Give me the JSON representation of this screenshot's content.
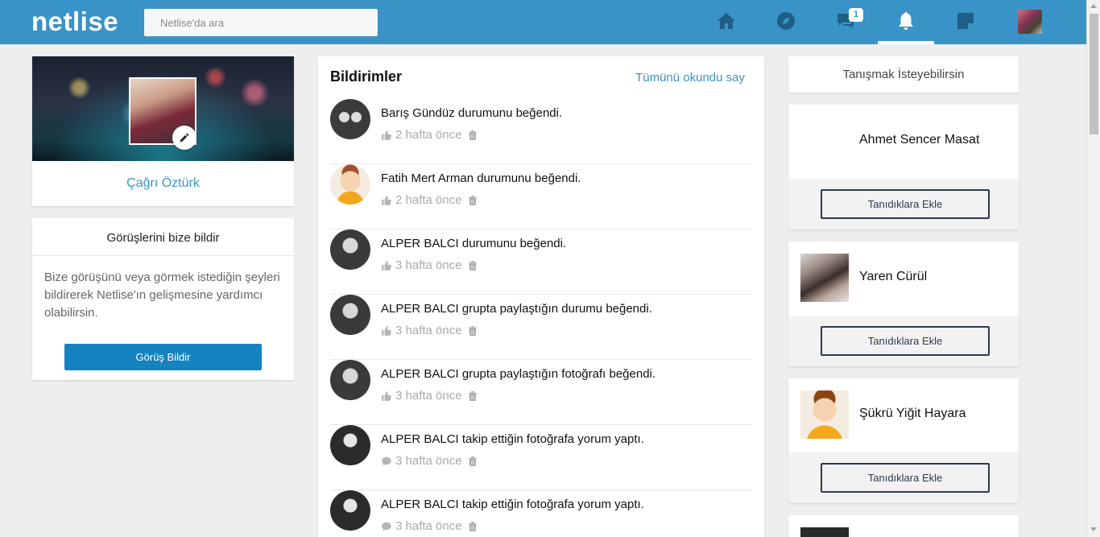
{
  "app": {
    "logo": "netlise"
  },
  "search": {
    "placeholder": "Netlise'da ara"
  },
  "nav": {
    "icons": [
      "home-icon",
      "compass-icon",
      "messages-icon",
      "bell-icon",
      "notes-icon"
    ],
    "messages_badge": "1",
    "active": "bell-icon"
  },
  "profile": {
    "name": "Çağrı Öztürk"
  },
  "feedback": {
    "title": "Görüşlerini bize bildir",
    "text": "Bize görüşünü veya görmek istediğin şeyleri bildirerek Netlise'ın gelişmesine yardımcı olabilirsin.",
    "button": "Görüş Bildir"
  },
  "notifications": {
    "title": "Bildirimler",
    "mark_all_read": "Tümünü okundu say",
    "items": [
      {
        "text": "Barış Gündüz durumunu beğendi.",
        "time": "2 hafta önce",
        "kind": "like"
      },
      {
        "text": "Fatih Mert Arman durumunu beğendi.",
        "time": "2 hafta önce",
        "kind": "like"
      },
      {
        "text": "ALPER BALCI durumunu beğendi.",
        "time": "3 hafta önce",
        "kind": "like"
      },
      {
        "text": "ALPER BALCI grupta paylaştığın durumu beğendi.",
        "time": "3 hafta önce",
        "kind": "like"
      },
      {
        "text": "ALPER BALCI grupta paylaştığın fotoğrafı beğendi.",
        "time": "3 hafta önce",
        "kind": "like"
      },
      {
        "text": "ALPER BALCI takip ettiğin fotoğrafa yorum yaptı.",
        "time": "3 hafta önce",
        "kind": "comment"
      },
      {
        "text": "ALPER BALCI takip ettiğin fotoğrafa yorum yaptı.",
        "time": "3 hafta önce",
        "kind": "comment"
      }
    ]
  },
  "suggestions": {
    "title": "Tanışmak İsteyebilirsin",
    "add_label": "Tanıdıklara Ekle",
    "people": [
      {
        "name": "Ahmet Sencer Masat"
      },
      {
        "name": "Yaren Cürül"
      },
      {
        "name": "Şükrü Yiğit Hayara"
      }
    ]
  },
  "colors": {
    "topbar": "#3a93c6",
    "accent": "#3a93c6",
    "button": "#1483c0",
    "background": "#eeeeee"
  }
}
